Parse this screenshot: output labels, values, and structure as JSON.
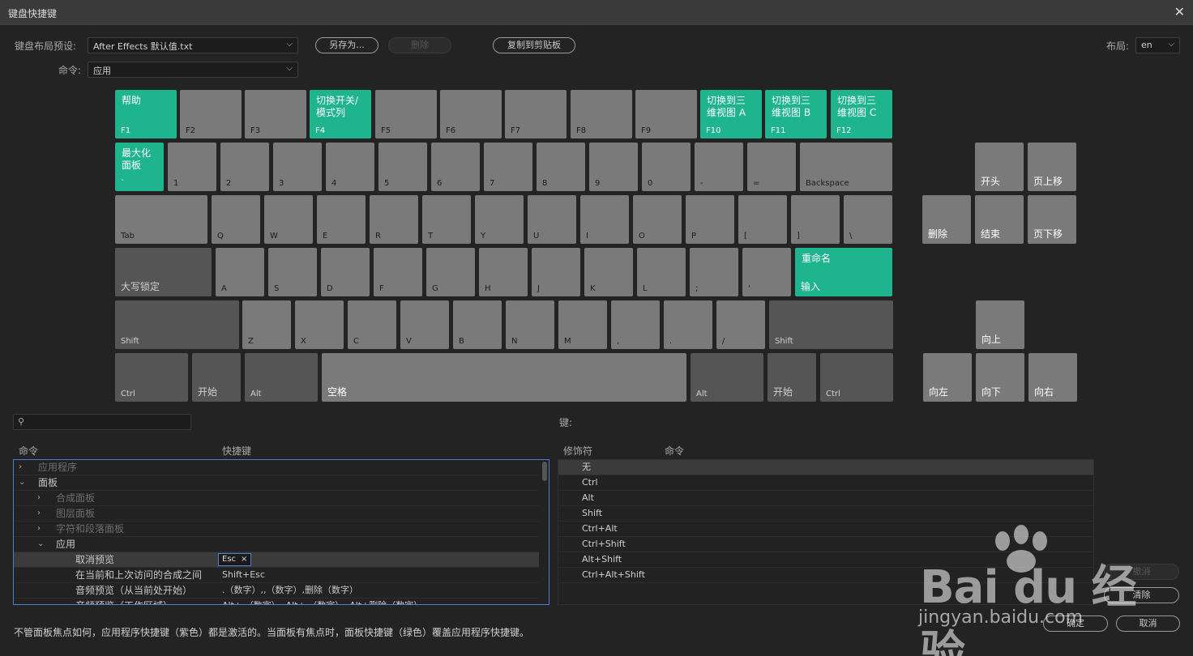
{
  "window": {
    "title": "键盘快捷键",
    "close_icon": "close-icon"
  },
  "toolbar": {
    "preset_label": "键盘布局预设:",
    "preset_value": "After Effects 默认值.txt",
    "save_as": "另存为...",
    "delete": "删除",
    "copy_clipboard": "复制到剪贴板",
    "layout_label": "布局:",
    "layout_value": "en",
    "command_label": "命令:",
    "command_value": "应用"
  },
  "keys": {
    "f1_cmd": "帮助",
    "f1": "F1",
    "f2": "F2",
    "f3": "F3",
    "f4_cmd": "切换开关/\n模式列",
    "f4": "F4",
    "f5": "F5",
    "f6": "F6",
    "f7": "F7",
    "f8": "F8",
    "f9": "F9",
    "f10_cmd": "切换到三\n维视图 A",
    "f10": "F10",
    "f11_cmd": "切换到三\n维视图 B",
    "f11": "F11",
    "f12_cmd": "切换到三\n维视图 C",
    "f12": "F12",
    "grave_cmd": "最大化\n面板",
    "grave": "`",
    "n1": "1",
    "n2": "2",
    "n3": "3",
    "n4": "4",
    "n5": "5",
    "n6": "6",
    "n7": "7",
    "n8": "8",
    "n9": "9",
    "n0": "0",
    "minus": "-",
    "equal": "=",
    "backspace": "Backspace",
    "tab": "Tab",
    "q": "Q",
    "w": "W",
    "e": "E",
    "r": "R",
    "t": "T",
    "y": "Y",
    "u": "U",
    "i": "I",
    "o": "O",
    "p": "P",
    "lbracket": "[",
    "rbracket": "]",
    "backslash": "\\",
    "capslock": "大写锁定",
    "a": "A",
    "s": "S",
    "d": "D",
    "f": "F",
    "g": "G",
    "h": "H",
    "j": "J",
    "k": "K",
    "l": "L",
    "semicolon": ";",
    "quote": "'",
    "enter_cmd": "重命名",
    "enter": "输入",
    "lshift": "Shift",
    "z": "Z",
    "x": "X",
    "c": "C",
    "v": "V",
    "b": "B",
    "n": "N",
    "m": "M",
    "comma": ",",
    "period": ".",
    "slash": "/",
    "rshift": "Shift",
    "lctrl": "Ctrl",
    "lwin": "开始",
    "lalt": "Alt",
    "space": "空格",
    "ralt": "Alt",
    "rwin": "开始",
    "rctrl": "Ctrl",
    "home": "开头",
    "pageup": "页上移",
    "delete": "删除",
    "end": "结束",
    "pagedown": "页下移",
    "up": "向上",
    "left": "向左",
    "down": "向下",
    "right": "向右"
  },
  "search": {
    "icon": "search-icon",
    "placeholder": ""
  },
  "key_label": "键:",
  "tree": {
    "col_command": "命令",
    "col_shortcut": "快捷键",
    "rows": [
      {
        "label": "应用程序"
      },
      {
        "label": "面板"
      },
      {
        "label": "合成面板"
      },
      {
        "label": "图层面板"
      },
      {
        "label": "字符和段落面板"
      },
      {
        "label": "应用"
      },
      {
        "label": "取消预览",
        "shortcut": "Esc"
      },
      {
        "label": "在当前和上次访问的合成之间",
        "shortcut": "Shift+Esc"
      },
      {
        "label": "音频预览（从当前处开始）",
        "shortcut": ".（数字）,,（数字）,删除（数字）"
      },
      {
        "label": "音频预览（工作区域）",
        "shortcut": "Alt+.（数字）, Alt+,（数字）, Alt+删除（数字）"
      }
    ]
  },
  "modifiers": {
    "col_modifier": "修饰符",
    "col_command": "命令",
    "rows": [
      "无",
      "Ctrl",
      "Alt",
      "Shift",
      "Ctrl+Alt",
      "Ctrl+Shift",
      "Alt+Shift",
      "Ctrl+Alt+Shift"
    ]
  },
  "footer": {
    "note": "不管面板焦点如何，应用程序快捷键（紫色）都是激活的。当面板有焦点时，面板快捷键（绿色）覆盖应用程序快捷键。",
    "undo": "撤消",
    "clear": "清除",
    "ok": "确定",
    "cancel": "取消"
  },
  "watermark": {
    "brand": "Bai du 经验",
    "url": "jingyan.baidu.com"
  },
  "colors": {
    "accent_green": "#1db48e",
    "focus_blue": "#4a7fd4",
    "key_gray": "#7a7a7a",
    "key_dark": "#555555"
  }
}
